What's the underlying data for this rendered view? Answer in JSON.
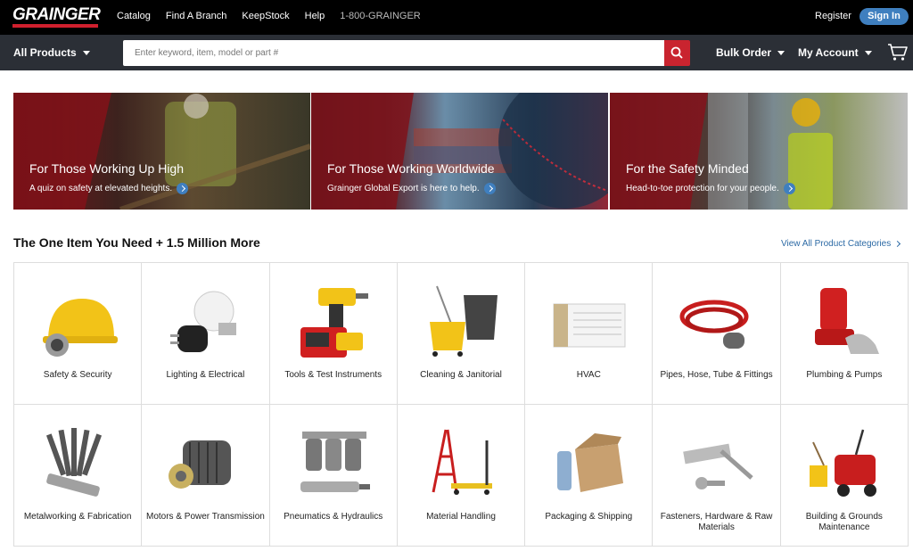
{
  "header": {
    "logo": "GRAINGER",
    "links": [
      "Catalog",
      "Find A Branch",
      "KeepStock",
      "Help"
    ],
    "phone": "1-800-GRAINGER",
    "register": "Register",
    "sign_in": "Sign In"
  },
  "nav": {
    "all_products": "All Products",
    "search_placeholder": "Enter keyword, item, model or part #",
    "bulk_order": "Bulk Order",
    "my_account": "My Account"
  },
  "banners": [
    {
      "title": "For Those Working Up High",
      "subtitle": "A quiz on safety at elevated heights."
    },
    {
      "title": "For Those Working Worldwide",
      "subtitle": "Grainger Global Export is here to help."
    },
    {
      "title": "For the Safety Minded",
      "subtitle": "Head-to-toe protection for your people."
    }
  ],
  "section": {
    "title": "The One Item You Need + 1.5 Million More",
    "view_all": "View All Product Categories"
  },
  "categories": [
    {
      "label": "Safety & Security",
      "icon": "hard-hat-icon"
    },
    {
      "label": "Lighting & Electrical",
      "icon": "light-bulb-icon"
    },
    {
      "label": "Tools & Test Instruments",
      "icon": "drill-icon"
    },
    {
      "label": "Cleaning & Janitorial",
      "icon": "mop-bucket-icon"
    },
    {
      "label": "HVAC",
      "icon": "air-conditioner-icon"
    },
    {
      "label": "Pipes, Hose, Tube & Fittings",
      "icon": "hose-icon"
    },
    {
      "label": "Plumbing & Pumps",
      "icon": "pump-icon"
    },
    {
      "label": "Metalworking & Fabrication",
      "icon": "wire-brush-icon"
    },
    {
      "label": "Motors & Power Transmission",
      "icon": "motor-icon"
    },
    {
      "label": "Pneumatics & Hydraulics",
      "icon": "pneumatics-icon"
    },
    {
      "label": "Material Handling",
      "icon": "ladder-icon"
    },
    {
      "label": "Packaging & Shipping",
      "icon": "box-icon"
    },
    {
      "label": "Fasteners, Hardware & Raw Materials",
      "icon": "fasteners-icon"
    },
    {
      "label": "Building & Grounds Maintenance",
      "icon": "snow-blower-icon"
    }
  ]
}
